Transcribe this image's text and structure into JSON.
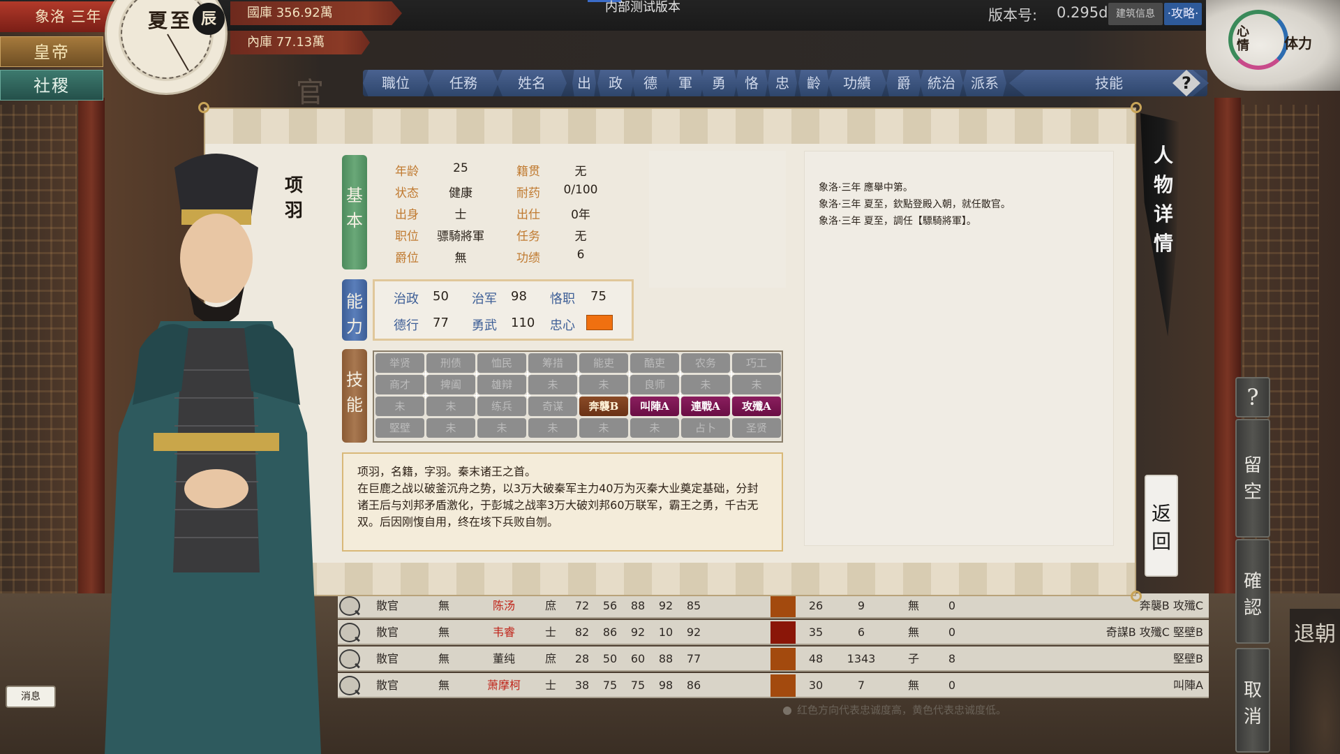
{
  "topbar": {
    "year": "象洛 三年",
    "season": "夏至",
    "shichen": "辰",
    "guoku": "國庫  356.92萬",
    "neiku": "內庫  77.13萬",
    "build_label": "内部测试版本",
    "version_label": "版本号:",
    "version_value": "0.295d",
    "build_info_btn": "建筑信息",
    "guide_btn": "·攻略·",
    "mood_xin": "心情",
    "mood_ti": "体力"
  },
  "sidebar": {
    "emperor": "皇帝",
    "sheji": "社稷",
    "news": "消息"
  },
  "guan_char": "官",
  "table": {
    "headers": [
      "職位",
      "任務",
      "姓名",
      "出",
      "政",
      "德",
      "軍",
      "勇",
      "恪",
      "忠",
      "齡",
      "功績",
      "爵",
      "統治",
      "派系",
      "技能"
    ],
    "help": "?",
    "rows": [
      {
        "pos": "散官",
        "task": "無",
        "name": "陈汤",
        "origin": "庶",
        "zheng": "72",
        "de": "56",
        "jun": "88",
        "yong": "92",
        "ke": "85",
        "loyal_color": "#a34a0e",
        "age": "26",
        "merit": "9",
        "jue": "無",
        "tongzhi": "0",
        "skills": "奔襲B  攻殲C",
        "red": true
      },
      {
        "pos": "散官",
        "task": "無",
        "name": "韦睿",
        "origin": "士",
        "zheng": "82",
        "de": "86",
        "jun": "92",
        "yong": "10",
        "ke": "92",
        "loyal_color": "#8a1608",
        "age": "35",
        "merit": "6",
        "jue": "無",
        "tongzhi": "0",
        "skills": "奇謀B  攻殲C  堅壁B",
        "red": true
      },
      {
        "pos": "散官",
        "task": "無",
        "name": "董纯",
        "origin": "庶",
        "zheng": "28",
        "de": "50",
        "jun": "60",
        "yong": "88",
        "ke": "77",
        "loyal_color": "#a34a0e",
        "age": "48",
        "merit": "1343",
        "jue": "子",
        "tongzhi": "8",
        "skills": "堅壁B",
        "red": false
      },
      {
        "pos": "散官",
        "task": "無",
        "name": "萧摩柯",
        "origin": "士",
        "zheng": "38",
        "de": "75",
        "jun": "75",
        "yong": "98",
        "ke": "86",
        "loyal_color": "#a34a0e",
        "age": "30",
        "merit": "7",
        "jue": "無",
        "tongzhi": "0",
        "skills": "叫陣A",
        "red": true
      }
    ],
    "legend": "红色方向代表忠诚度高，黄色代表忠诚度低。"
  },
  "modal": {
    "name_vertical": "项羽",
    "basic_tab": "基本",
    "ability_tab": "能力",
    "skill_tab": "技能",
    "basic": {
      "age_label": "年龄",
      "age": "25",
      "native_label": "籍贯",
      "native": "无",
      "status_label": "状态",
      "status": "健康",
      "resist_label": "耐药",
      "resist": "0/100",
      "birth_label": "出身",
      "birth": "士",
      "career_label": "出仕",
      "career": "0年",
      "position_label": "职位",
      "position": "骠騎將軍",
      "task_label": "任务",
      "task": "无",
      "rank_label": "爵位",
      "rank": "無",
      "merit_label": "功绩",
      "merit": "6"
    },
    "ability": {
      "zhengzhi_label": "治政",
      "zhengzhi": "50",
      "zhijun_label": "治军",
      "zhijun": "98",
      "kezhi_label": "恪职",
      "kezhi": "75",
      "dexing_label": "德行",
      "dexing": "77",
      "yongwu_label": "勇武",
      "yongwu": "110",
      "loyalty_label": "忠心",
      "loyalty_color": "#f07010"
    },
    "skills": [
      [
        "举贤",
        "刑债",
        "恤民",
        "筹措",
        "能吏",
        "酷吏",
        "农务",
        "巧工"
      ],
      [
        "商才",
        "捭阖",
        "雄辩",
        "未",
        "未",
        "良师",
        "未",
        "未"
      ],
      [
        "未",
        "未",
        "练兵",
        "奇谋",
        "奔襲B",
        "叫陣A",
        "連戰A",
        "攻殲A"
      ],
      [
        "堅壁",
        "未",
        "未",
        "未",
        "未",
        "未",
        "占卜",
        "圣贤"
      ]
    ],
    "bio": [
      "项羽，名籍，字羽。秦末诸王之首。",
      "在巨鹿之战以破釜沉舟之势，以3万大破秦军主力40万为灭秦大业奠定基础，分封诸王后与刘邦矛盾激化，于彭城之战率3万大破刘邦60万联军，霸王之勇，千古无双。后因刚愎自用，终在垓下兵败自刎。"
    ],
    "log": [
      "象洛·三年 應舉中第。",
      "象洛·三年 夏至，欽點登殿入朝，就任散官。",
      "象洛·三年 夏至，調任【驃騎將軍】。"
    ],
    "title_vertical": "人物详情",
    "back_btn": "返回"
  },
  "right": {
    "help": "?",
    "vacant": "留空",
    "confirm": "確認",
    "cancel": "取消",
    "tuichao": "退朝"
  }
}
